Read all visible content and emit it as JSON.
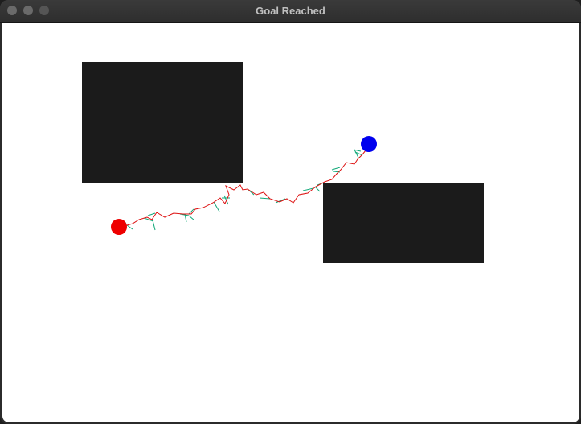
{
  "window": {
    "title": "Goal Reached"
  },
  "colors": {
    "obstacle": "#1b1b1b",
    "start": "#ee0000",
    "goal": "#0000ee",
    "path": "#dd1111",
    "tree": "#10a878",
    "background": "#ffffff"
  }
}
